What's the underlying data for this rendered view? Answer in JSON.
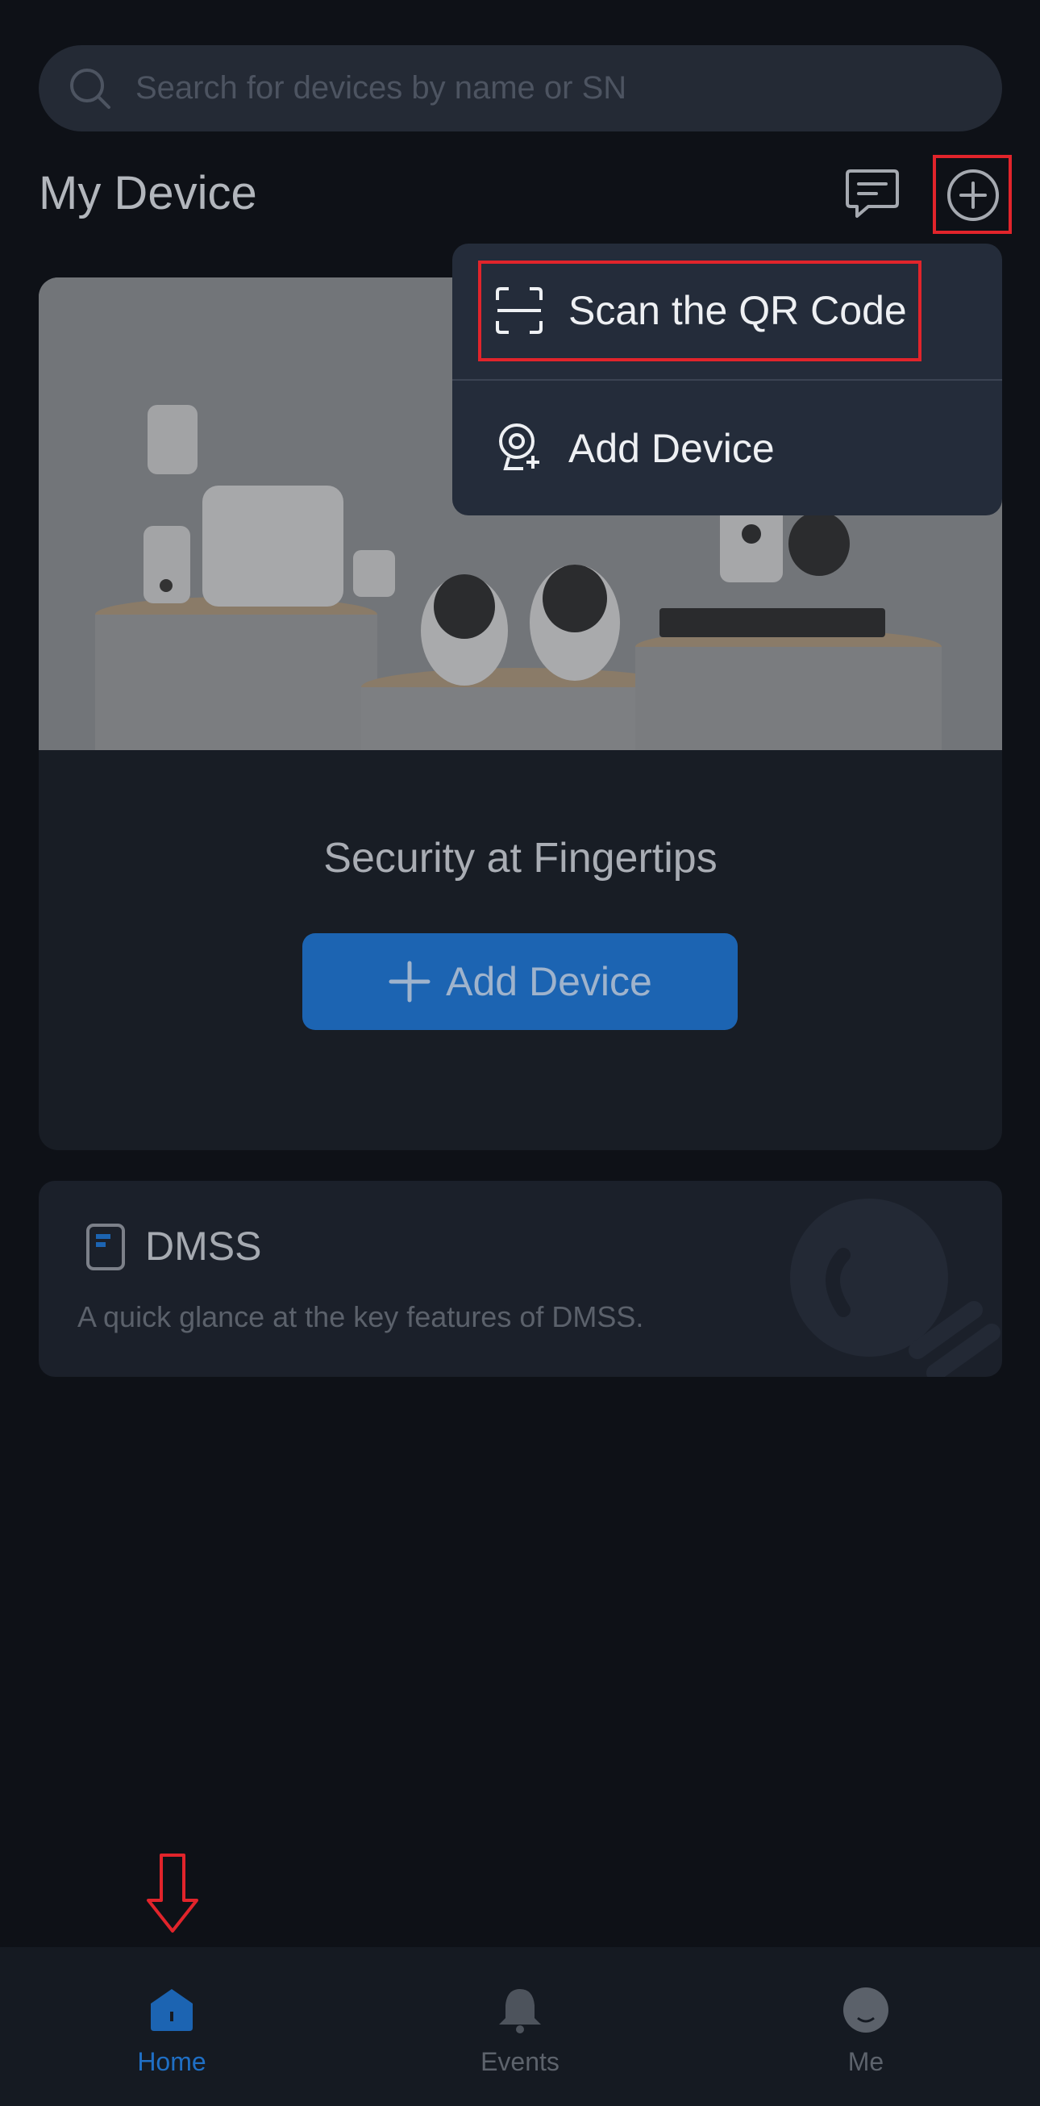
{
  "search": {
    "placeholder": "Search for devices by name or SN"
  },
  "header": {
    "title": "My Device"
  },
  "hero": {
    "title": "Security at Fingertips",
    "button_label": "Add Device"
  },
  "dmss": {
    "name": "DMSS",
    "description": "A quick glance at the key features of DMSS."
  },
  "menu": {
    "items": [
      {
        "label": "Scan the QR Code",
        "icon": "scan-qr-icon"
      },
      {
        "label": "Add Device",
        "icon": "add-camera-icon"
      }
    ]
  },
  "tabs": [
    {
      "label": "Home",
      "icon": "home-icon",
      "active": true
    },
    {
      "label": "Events",
      "icon": "bell-icon",
      "active": false
    },
    {
      "label": "Me",
      "icon": "profile-icon",
      "active": false
    }
  ],
  "colors": {
    "background": "#0e1117",
    "accent": "#1c64b2",
    "highlight": "#e1242b",
    "active_tab": "#1f6fc5"
  }
}
